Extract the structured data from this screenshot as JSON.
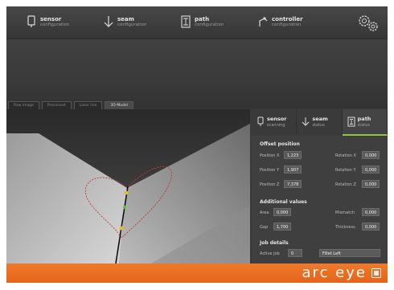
{
  "nav": [
    {
      "label": "sensor",
      "sub": "configuration",
      "icon": "sensor-icon"
    },
    {
      "label": "seam",
      "sub": "configuration",
      "icon": "seam-icon"
    },
    {
      "label": "path",
      "sub": "configuration",
      "icon": "path-icon"
    },
    {
      "label": "controller",
      "sub": "configuration",
      "icon": "controller-icon"
    }
  ],
  "nav_settings_icon": "gears-icon",
  "view_tabs": [
    "Raw image",
    "Processed",
    "Laser line",
    "3D-Model"
  ],
  "panel_tabs": [
    {
      "label": "sensor",
      "sub": "scanning",
      "icon": "sensor-icon"
    },
    {
      "label": "seam",
      "sub": "status",
      "icon": "seam-icon"
    },
    {
      "label": "path",
      "sub": "status",
      "icon": "path-icon"
    }
  ],
  "active_panel_tab": 2,
  "offset": {
    "title": "Offset position",
    "rows": [
      {
        "label": "Position X",
        "value": "1,223",
        "rlabel": "Rotation X",
        "rvalue": "0,000"
      },
      {
        "label": "Position Y",
        "value": "1,907",
        "rlabel": "Rotation Y",
        "rvalue": "0,000"
      },
      {
        "label": "Position Z",
        "value": "7,378",
        "rlabel": "Rotation Z",
        "rvalue": "0,000"
      }
    ]
  },
  "additional": {
    "title": "Additional values",
    "rows": [
      {
        "label": "Area",
        "value": "0,000",
        "rlabel": "Mismatch",
        "rvalue": "0,000"
      },
      {
        "label": "Gap",
        "value": "1,700",
        "rlabel": "Thickness",
        "rvalue": "0,000"
      }
    ]
  },
  "job": {
    "title": "Job details",
    "active_label": "Active job",
    "active_value": "0",
    "job_name": "Fillet Left"
  },
  "brand": {
    "text": "arc eye",
    "logo_icon": "brand-logo-icon"
  },
  "colors": {
    "accent_orange": "#ee6f22",
    "active_tab_green": "#8cc63f",
    "trace_red": "#c23a3a",
    "point_yellow": "#e0c020",
    "point_green": "#5cc040"
  }
}
